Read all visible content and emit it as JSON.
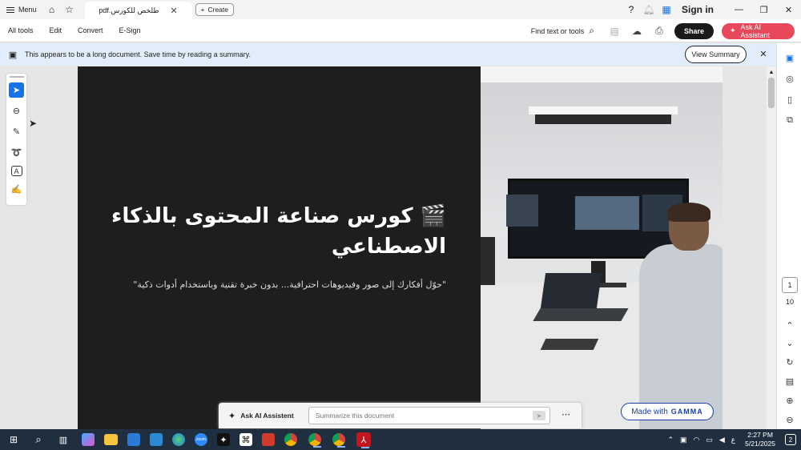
{
  "titlebar": {
    "menu_label": "Menu",
    "tab_title": "pdf.طلخص للكورس",
    "create_label": "Create",
    "signin_label": "Sign in"
  },
  "toolbar": {
    "menu_items": [
      "All tools",
      "Edit",
      "Convert",
      "E-Sign"
    ],
    "find_label": "Find text or tools",
    "share_label": "Share",
    "ai_assistant_label": "Ask AI Assistant"
  },
  "notice": {
    "text": "This appears to be a long document. Save time by reading a summary.",
    "view_summary_label": "View Summary"
  },
  "document": {
    "title_line1": "🎬 كورس صناعة المحتوى بالذكاء",
    "title_line2": "الاصطناعي",
    "subtitle": "\"حوّل أفكارك إلى صور وفيديوهات احترافية... بدون خبرة تقنية وباستخدام أدوات ذكية\"",
    "badge_prefix": "Made with",
    "badge_brand": "GAMMA"
  },
  "ask_ai": {
    "label": "Ask AI Assistent",
    "placeholder": "Summarize this document"
  },
  "pagination": {
    "current_page": "1",
    "total_pages": "10"
  },
  "taskbar": {
    "time": "2:27 PM",
    "date": "5/21/2025",
    "lang": "ع",
    "notifications": "2"
  },
  "colors": {
    "accent_blue": "#1473e6",
    "ai_button": "#e8485a",
    "notice_bg": "#e1edfb",
    "gamma_blue": "#1a3fa8",
    "taskbar_bg": "#1f2f3f"
  }
}
